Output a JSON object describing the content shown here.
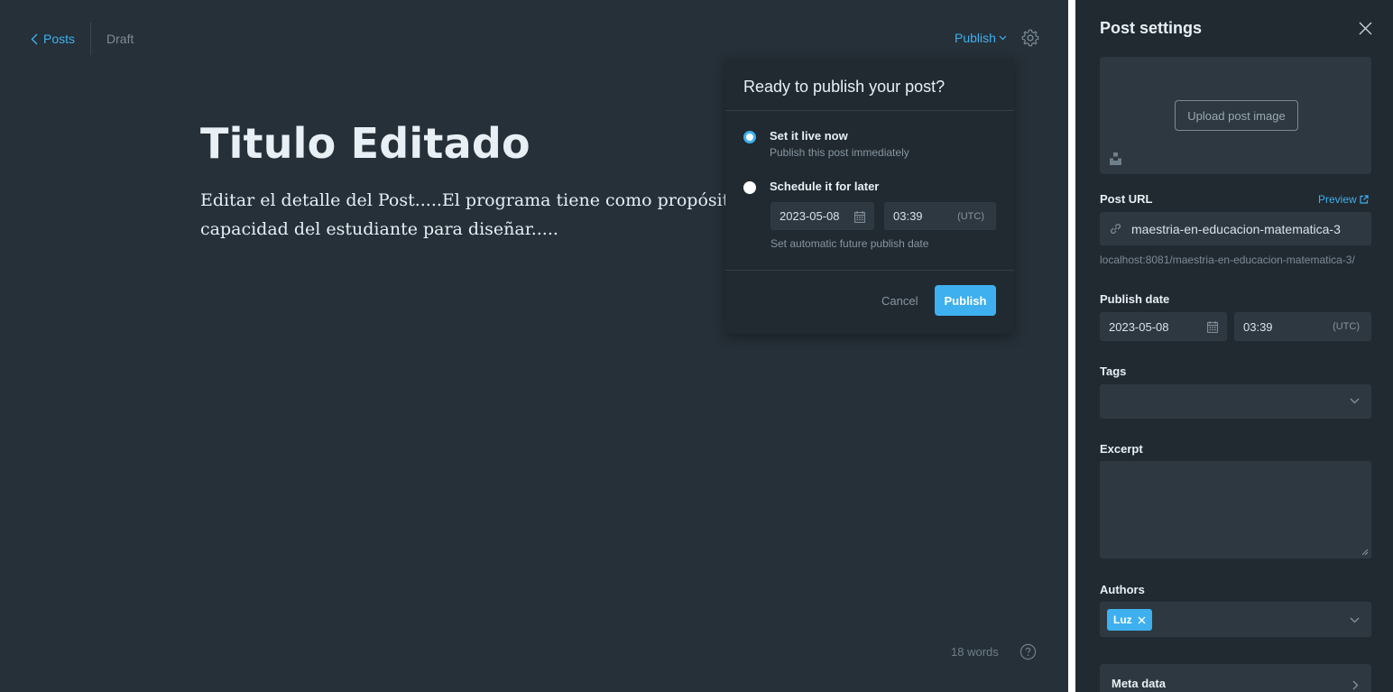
{
  "colors": {
    "accent": "#3eb0ef",
    "editor_bg": "#263038",
    "panel_bg": "#212a31",
    "field_bg": "#2d3840",
    "muted_text": "#8795a0"
  },
  "header": {
    "back_label": "Posts",
    "status": "Draft",
    "publish_menu_label": "Publish",
    "settings_icon": "gear-icon"
  },
  "post": {
    "title": "Titulo Editado",
    "body_line1": "Editar el detalle del Post.....El programa tiene como propósito con",
    "body_line2": "capacidad del estudiante para diseñar....."
  },
  "footer": {
    "word_count": "18 words",
    "help_icon": "question-circle-icon"
  },
  "publish_popover": {
    "title": "Ready to publish your post?",
    "option_now": {
      "label": "Set it live now",
      "description": "Publish this post immediately",
      "selected": true
    },
    "option_later": {
      "label": "Schedule it for later",
      "date": "2023-05-08",
      "time": "03:39",
      "timezone": "(UTC)",
      "note": "Set automatic future publish date",
      "selected": false
    },
    "cancel_label": "Cancel",
    "publish_label": "Publish"
  },
  "settings": {
    "title": "Post settings",
    "upload_label": "Upload post image",
    "post_url_label": "Post URL",
    "preview_label": "Preview",
    "slug": "maestria-en-educacion-matematica-3",
    "full_url": "localhost:8081/maestria-en-educacion-matematica-3/",
    "publish_date_label": "Publish date",
    "publish_date": "2023-05-08",
    "publish_time": "03:39",
    "timezone": "(UTC)",
    "tags_label": "Tags",
    "excerpt_label": "Excerpt",
    "authors_label": "Authors",
    "authors": [
      "Luz"
    ],
    "meta_data_label": "Meta data"
  }
}
